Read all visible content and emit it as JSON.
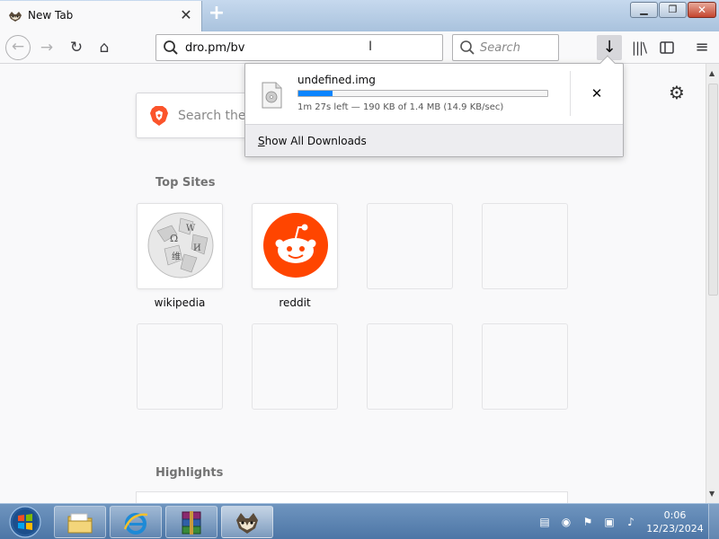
{
  "browser": {
    "tab": {
      "title": "New Tab",
      "close_glyph": "✕"
    },
    "new_tab_glyph": "+",
    "window_controls": {
      "minimize": "▁",
      "maximize": "❐",
      "close": "✕"
    },
    "toolbar": {
      "back_icon": "←",
      "forward_icon": "→",
      "reload_icon": "↻",
      "home_icon": "⌂",
      "url": "dro.pm/bv",
      "search_placeholder": "Search",
      "downloads_icon": "↓",
      "library_icon": "|||\\",
      "sidebar_icon": "▯",
      "menu_icon": "≡"
    }
  },
  "newtab": {
    "search_placeholder": "Search the W",
    "settings_icon": "⚙",
    "top_sites_title": "Top Sites",
    "top_sites": [
      {
        "label": "wikipedia",
        "icon": "wikipedia-globe-icon"
      },
      {
        "label": "reddit",
        "icon": "reddit-snoo-icon"
      },
      {
        "label": "",
        "icon": ""
      },
      {
        "label": "",
        "icon": ""
      },
      {
        "label": "",
        "icon": ""
      },
      {
        "label": "",
        "icon": ""
      },
      {
        "label": "",
        "icon": ""
      },
      {
        "label": "",
        "icon": ""
      }
    ],
    "highlights_title": "Highlights"
  },
  "downloads_panel": {
    "filename": "undefined.img",
    "status": "1m 27s left — 190 KB of 1.4 MB (14.9 KB/sec)",
    "progress_fraction": 0.136,
    "cancel_glyph": "✕",
    "footer_label_prefix": "S",
    "footer_label_rest": "how All Downloads",
    "accent_color": "#0a84ff"
  },
  "taskbar": {
    "items": [
      "start-orb-icon",
      "file-explorer-icon",
      "internet-explorer-icon",
      "winrar-icon",
      "browser-raccoon-icon"
    ],
    "clock_time": "0:06",
    "clock_date": "12/23/2024"
  }
}
